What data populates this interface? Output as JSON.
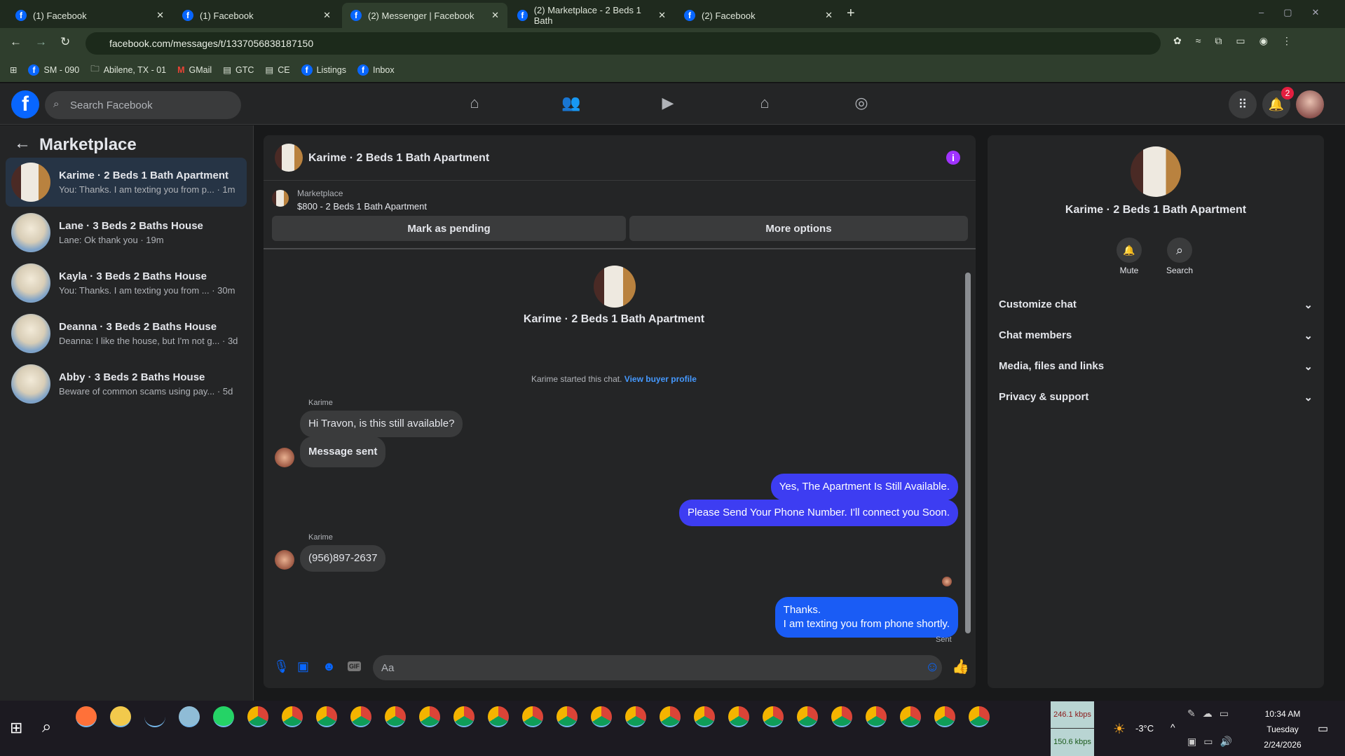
{
  "browser": {
    "tabs": [
      {
        "label": "(1) Facebook"
      },
      {
        "label": "(1) Facebook"
      },
      {
        "label": "(2) Messenger | Facebook",
        "active": true
      },
      {
        "label": "(2) Marketplace - 2 Beds 1 Bath"
      },
      {
        "label": "(2) Facebook"
      }
    ],
    "url": "facebook.com/messages/t/1337056838187150",
    "bookmarks": [
      "SM - 090",
      "Abilene, TX - 01",
      "GMail",
      "GTC",
      "CE",
      "Listings",
      "Inbox"
    ]
  },
  "fb": {
    "search_placeholder": "Search Facebook",
    "notif_count": "2"
  },
  "sidebar": {
    "title": "Marketplace",
    "conversations": [
      {
        "title": "Karime · 2 Beds 1 Bath Apartment",
        "snippet": "You: Thanks. I am texting you from p... · 1m"
      },
      {
        "title": "Lane · 3 Beds 2 Baths House",
        "snippet": "Lane: Ok thank you · 19m"
      },
      {
        "title": "Kayla · 3 Beds 2 Baths House",
        "snippet": "You: Thanks. I am texting you from ... · 30m"
      },
      {
        "title": "Deanna · 3 Beds 2 Baths House",
        "snippet": "Deanna: I like the house, but I'm not g... · 3d"
      },
      {
        "title": "Abby · 3 Beds 2 Baths House",
        "snippet": "Beware of common scams using pay... · 5d"
      }
    ]
  },
  "chat": {
    "title": "Karime · 2 Beds 1 Bath Apartment",
    "listing_label": "Marketplace",
    "listing_title": "$800 - 2 Beds 1 Bath Apartment",
    "mark_pending": "Mark as pending",
    "more_options": "More options",
    "intro_name": "Karime · 2 Beds 1 Bath Apartment",
    "started": "Karime started this chat.",
    "view_profile": "View buyer profile",
    "messages": [
      {
        "sender": "Karime",
        "text": "Hi Travon, is this still available?"
      },
      {
        "text": "Message sent"
      },
      {
        "text": "Yes, The Apartment Is Still Available."
      },
      {
        "text": "Please Send Your Phone Number. I'll connect you Soon."
      },
      {
        "sender": "Karime",
        "text": "(956)897-2637"
      },
      {
        "text": "Thanks.\nI am texting you from phone shortly."
      }
    ],
    "status": "Sent",
    "composer_placeholder": "Aa"
  },
  "right": {
    "name": "Karime · 2 Beds 1 Bath Apartment",
    "mute": "Mute",
    "search": "Search",
    "sections": [
      "Customize chat",
      "Chat members",
      "Media, files and links",
      "Privacy & support"
    ]
  },
  "taskbar": {
    "net_up": "246.1 kbps",
    "net_down": "150.6 kbps",
    "weather": "-3°C",
    "time": "10:34 AM",
    "day": "Tuesday",
    "date": "2/24/2026"
  },
  "colors": {
    "accent": "#0866ff",
    "outgoing": "#3d3df2",
    "info": "#a033ff"
  }
}
